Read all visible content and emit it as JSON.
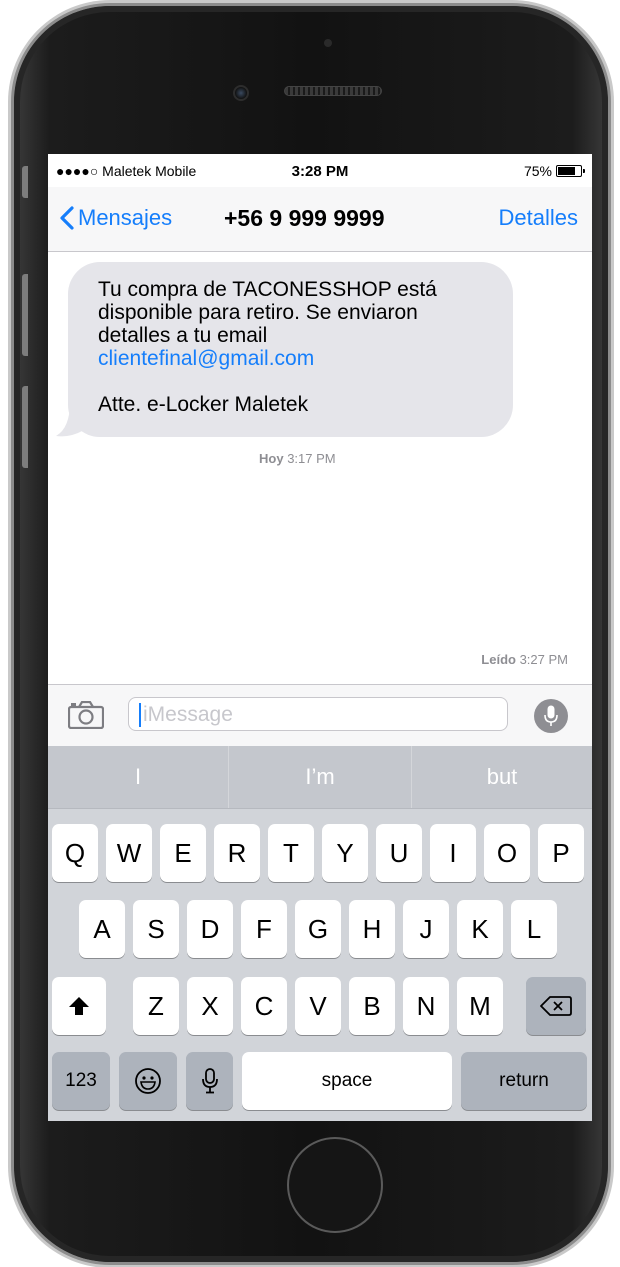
{
  "status": {
    "carrier": "●●●●○ Maletek Mobile",
    "time": "3:28 PM",
    "battery_pct": "75%",
    "battery_level": 0.75
  },
  "nav": {
    "back_label": "Mensajes",
    "title": "+56 9 999 9999",
    "details_label": "Detalles"
  },
  "message": {
    "lines": [
      "Tu compra de TACONESSHOP está",
      "disponible para retiro. Se enviaron",
      "detalles a tu email"
    ],
    "email": "clientefinal@gmail.com",
    "signature": "Atte. e-Locker Maletek"
  },
  "timestamps": {
    "sent_day": "Hoy",
    "sent_time": "3:17 PM",
    "read_label": "Leído",
    "read_time": "3:27 PM"
  },
  "input": {
    "placeholder": "iMessage"
  },
  "suggestions": [
    "I",
    "I’m",
    "but"
  ],
  "keyboard": {
    "row1": [
      "Q",
      "W",
      "E",
      "R",
      "T",
      "Y",
      "U",
      "I",
      "O",
      "P"
    ],
    "row2": [
      "A",
      "S",
      "D",
      "F",
      "G",
      "H",
      "J",
      "K",
      "L"
    ],
    "row3": [
      "Z",
      "X",
      "C",
      "V",
      "B",
      "N",
      "M"
    ],
    "numbers_label": "123",
    "space_label": "space",
    "return_label": "return"
  },
  "colors": {
    "accent": "#157efb",
    "bubble": "#e5e5ea",
    "keyboard_bg": "#d1d4d9"
  },
  "icons": [
    "chevron-left-icon",
    "camera-icon",
    "microphone-icon",
    "shift-icon",
    "backspace-icon",
    "emoji-icon",
    "dictation-icon"
  ]
}
